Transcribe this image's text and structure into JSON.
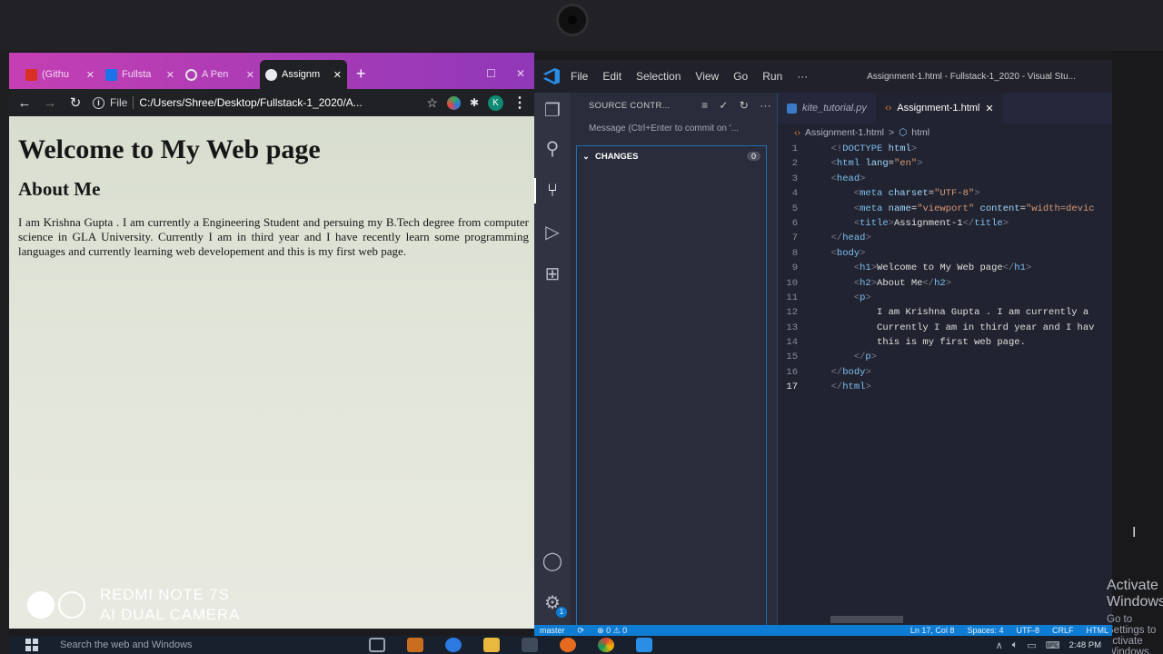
{
  "chrome": {
    "tabs": [
      {
        "title": "(Githu",
        "icon": "gmail-icon",
        "color": "#d93025"
      },
      {
        "title": "Fullsta",
        "icon": "user-icon",
        "color": "#1a73e8"
      },
      {
        "title": "A Pen",
        "icon": "codepen-icon",
        "color": "#cfcfcf"
      },
      {
        "title": "Assignm",
        "icon": "globe-icon",
        "color": "#ffffff"
      }
    ],
    "new_tab": "+",
    "address": {
      "scheme": "File",
      "url": "C:/Users/Shree/Desktop/Fullstack-1_2020/A..."
    },
    "profile_initial": "K",
    "page": {
      "h1": "Welcome to My Web page",
      "h2": "About Me",
      "paragraph": "I am Krishna Gupta . I am currently a Engineering Student and persuing my B.Tech degree from computer science in GLA University. Currently I am in third year and I have recently learn some programming languages and currently learning web developement and this is my first web page."
    }
  },
  "vscode": {
    "menu": [
      "File",
      "Edit",
      "Selection",
      "View",
      "Go",
      "Run",
      "···"
    ],
    "window_title": "Assignment-1.html - Fullstack-1_2020 - Visual Stu...",
    "sidebar": {
      "title": "SOURCE CONTR...",
      "commit_placeholder": "Message (Ctrl+Enter to commit on '...",
      "changes_label": "CHANGES",
      "changes_count": "0"
    },
    "tabs": [
      {
        "label": "kite_tutorial.py",
        "active": false
      },
      {
        "label": "Assignment-1.html",
        "active": true
      }
    ],
    "breadcrumb": {
      "file": "Assignment-1.html",
      "sep": ">",
      "node": "html"
    },
    "code_lines": [
      {
        "n": "1",
        "indent": "  ",
        "parts": [
          [
            "br",
            "<!"
          ],
          [
            "tag",
            "DOCTYPE"
          ],
          [
            "txt",
            " "
          ],
          [
            "attr",
            "html"
          ],
          [
            "br",
            ">"
          ]
        ]
      },
      {
        "n": "2",
        "indent": "  ",
        "parts": [
          [
            "br",
            "<"
          ],
          [
            "tag",
            "html"
          ],
          [
            "txt",
            " "
          ],
          [
            "attr",
            "lang"
          ],
          [
            "txt",
            "="
          ],
          [
            "str",
            "\"en\""
          ],
          [
            "br",
            ">"
          ]
        ]
      },
      {
        "n": "3",
        "indent": "  ",
        "parts": [
          [
            "br",
            "<"
          ],
          [
            "tag",
            "head"
          ],
          [
            "br",
            ">"
          ]
        ]
      },
      {
        "n": "4",
        "indent": "      ",
        "parts": [
          [
            "br",
            "<"
          ],
          [
            "tag",
            "meta"
          ],
          [
            "txt",
            " "
          ],
          [
            "attr",
            "charset"
          ],
          [
            "txt",
            "="
          ],
          [
            "str",
            "\"UTF-8\""
          ],
          [
            "br",
            ">"
          ]
        ]
      },
      {
        "n": "5",
        "indent": "      ",
        "parts": [
          [
            "br",
            "<"
          ],
          [
            "tag",
            "meta"
          ],
          [
            "txt",
            " "
          ],
          [
            "attr",
            "name"
          ],
          [
            "txt",
            "="
          ],
          [
            "str",
            "\"viewport\""
          ],
          [
            "txt",
            " "
          ],
          [
            "attr",
            "content"
          ],
          [
            "txt",
            "="
          ],
          [
            "str",
            "\"width=devic"
          ]
        ]
      },
      {
        "n": "6",
        "indent": "      ",
        "parts": [
          [
            "br",
            "<"
          ],
          [
            "tag",
            "title"
          ],
          [
            "br",
            ">"
          ],
          [
            "txt",
            "Assignment-1"
          ],
          [
            "br",
            "</"
          ],
          [
            "tag",
            "title"
          ],
          [
            "br",
            ">"
          ]
        ]
      },
      {
        "n": "7",
        "indent": "  ",
        "parts": [
          [
            "br",
            "</"
          ],
          [
            "tag",
            "head"
          ],
          [
            "br",
            ">"
          ]
        ]
      },
      {
        "n": "8",
        "indent": "  ",
        "parts": [
          [
            "br",
            "<"
          ],
          [
            "tag",
            "body"
          ],
          [
            "br",
            ">"
          ]
        ]
      },
      {
        "n": "9",
        "indent": "      ",
        "parts": [
          [
            "br",
            "<"
          ],
          [
            "tag",
            "h1"
          ],
          [
            "br",
            ">"
          ],
          [
            "txt",
            "Welcome to My Web page"
          ],
          [
            "br",
            "</"
          ],
          [
            "tag",
            "h1"
          ],
          [
            "br",
            ">"
          ]
        ]
      },
      {
        "n": "10",
        "indent": "      ",
        "parts": [
          [
            "br",
            "<"
          ],
          [
            "tag",
            "h2"
          ],
          [
            "br",
            ">"
          ],
          [
            "txt",
            "About Me"
          ],
          [
            "br",
            "</"
          ],
          [
            "tag",
            "h2"
          ],
          [
            "br",
            ">"
          ]
        ]
      },
      {
        "n": "11",
        "indent": "      ",
        "parts": [
          [
            "br",
            "<"
          ],
          [
            "tag",
            "p"
          ],
          [
            "br",
            ">"
          ]
        ]
      },
      {
        "n": "12",
        "indent": "          ",
        "parts": [
          [
            "txt",
            "I am Krishna Gupta . I am currently a"
          ]
        ]
      },
      {
        "n": "13",
        "indent": "          ",
        "parts": [
          [
            "txt",
            "Currently I am in third year and I hav"
          ]
        ]
      },
      {
        "n": "14",
        "indent": "          ",
        "parts": [
          [
            "txt",
            "this is my first web page."
          ]
        ]
      },
      {
        "n": "15",
        "indent": "      ",
        "parts": [
          [
            "br",
            "</"
          ],
          [
            "tag",
            "p"
          ],
          [
            "br",
            ">"
          ]
        ]
      },
      {
        "n": "16",
        "indent": "  ",
        "parts": [
          [
            "br",
            "</"
          ],
          [
            "tag",
            "body"
          ],
          [
            "br",
            ">"
          ]
        ]
      },
      {
        "n": "17",
        "indent": "  ",
        "parts": [
          [
            "br",
            "</"
          ],
          [
            "tag",
            "html"
          ],
          [
            "br",
            ">"
          ]
        ]
      }
    ],
    "activate_windows": {
      "title": "Activate Windows",
      "subtitle": "Go to Settings to activate Windows."
    },
    "statusbar": {
      "branch": "master",
      "problems": "⊗ 0 ⚠ 0",
      "position": "Ln 17, Col 8",
      "spaces": "Spaces: 4",
      "encoding": "UTF-8",
      "eol": "CRLF",
      "language": "HTML"
    },
    "accounts_badge": "1"
  },
  "taskbar": {
    "search": "Search the web and Windows",
    "clock": "2:48 PM"
  },
  "camera_watermark": {
    "line1": "REDMI NOTE 7S",
    "line2": "AI DUAL CAMERA"
  },
  "colors": {
    "vscode_blue": "#0e7cd3",
    "chrome_tab_gradient": "#c53fb3"
  }
}
